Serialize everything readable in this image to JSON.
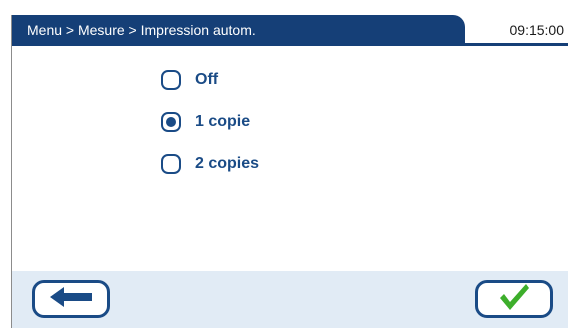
{
  "header": {
    "breadcrumb": "Menu > Mesure > Impression autom.",
    "time": "09:15:00"
  },
  "options": [
    {
      "label": "Off",
      "selected": false
    },
    {
      "label": "1 copie",
      "selected": true
    },
    {
      "label": "2 copies",
      "selected": false
    }
  ],
  "footer": {
    "back_icon": "arrow-left-icon",
    "confirm_icon": "checkmark-icon"
  },
  "colors": {
    "title_bar": "#153f77",
    "accent": "#1a4b86",
    "footer_bg": "#e1ebf5",
    "checkmark": "#3dae2b"
  }
}
